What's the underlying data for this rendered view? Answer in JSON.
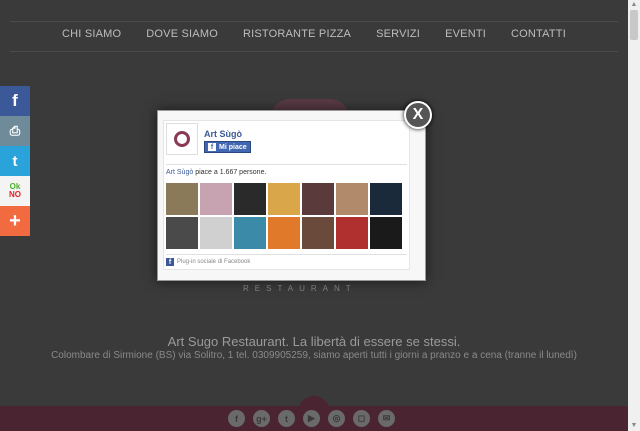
{
  "nav": {
    "items": [
      "CHI SIAMO",
      "DOVE SIAMO",
      "RISTORANTE PIZZA",
      "SERVIZI",
      "EVENTI",
      "CONTATTI"
    ]
  },
  "hero": {
    "restaurant_word": "RESTAURANT",
    "tagline": "Art Sugo Restaurant. La libertà di essere se stessi.",
    "address": "Colombare di Sirmione (BS) via Solitro, 1 tel. 0309905259, siamo aperti tutti i giorni a pranzo e a cena (tranne il lunedì)"
  },
  "share_bar": {
    "facebook": "f",
    "print": "⎙",
    "twitter": "t",
    "ok": "Ok",
    "no": "NO",
    "more": "+"
  },
  "modal": {
    "close_label": "X",
    "page_name": "Art Sùgò",
    "like_button": "Mi piace",
    "like_icon": "f",
    "count_link": "Art Sùgò",
    "count_text": " piace a 1.667 persone.",
    "plugin_label": "Plug-in sociale di Facebook",
    "plugin_icon": "f",
    "faces": [
      "#8a7a5a",
      "#c7a3b2",
      "#2a2a2a",
      "#d9a64a",
      "#5a3a3a",
      "#b08a6a",
      "#1a2a3a",
      "#4a4a4a",
      "#d0d0d0",
      "#3a8aa8",
      "#e07a2a",
      "#6a4a3a",
      "#b03030",
      "#1a1a1a"
    ]
  },
  "footer": {
    "icons": [
      "f",
      "g+",
      "t",
      "▶",
      "◎",
      "◻",
      "✉"
    ]
  }
}
